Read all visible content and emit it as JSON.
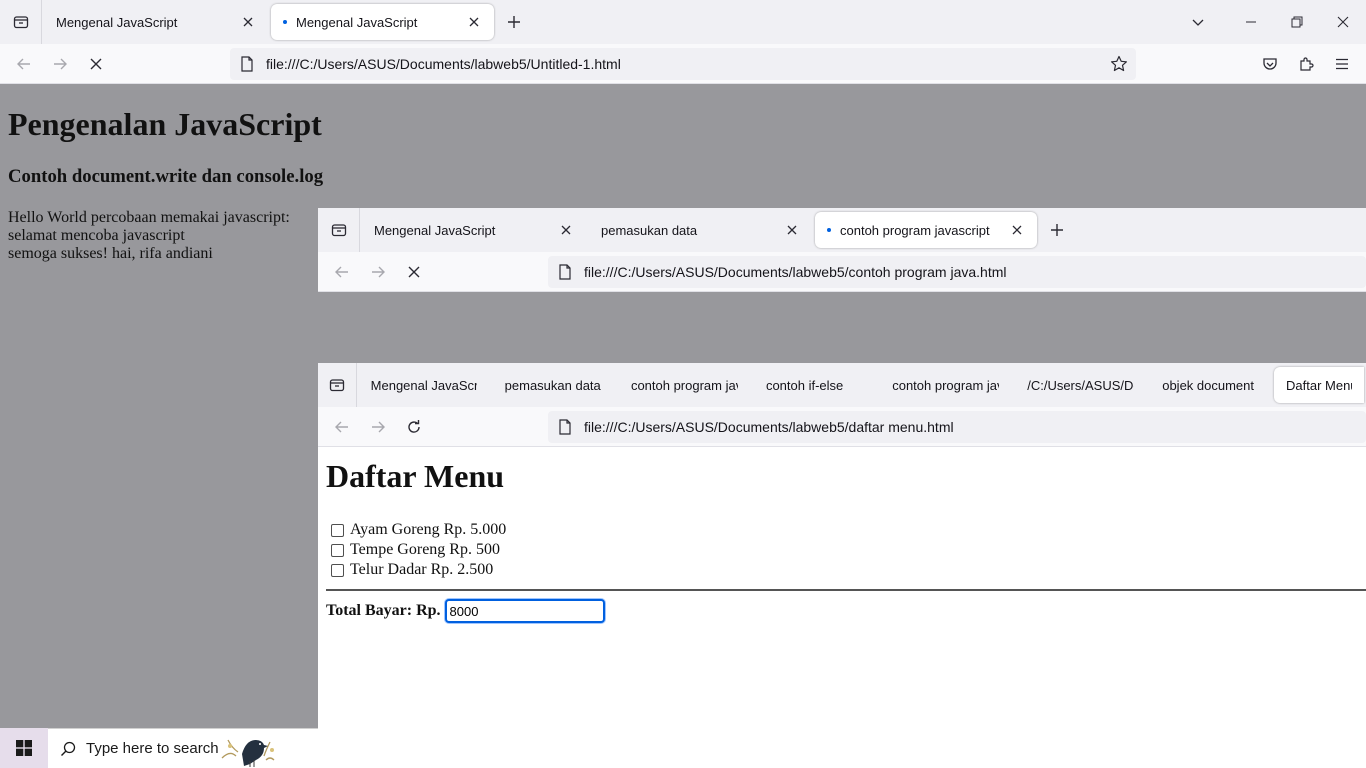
{
  "window1": {
    "tabs": [
      {
        "label": "Mengenal JavaScript",
        "active": false
      },
      {
        "label": "Mengenal JavaScript",
        "active": true,
        "loading": true
      }
    ],
    "url": "file:///C:/Users/ASUS/Documents/labweb5/Untitled-1.html",
    "content": {
      "heading": "Pengenalan JavaScript",
      "subheading": "Contoh document.write dan console.log",
      "lines": [
        "Hello World percobaan memakai javascript:",
        "selamat mencoba javascript",
        "semoga sukses! hai, rifa andiani"
      ]
    }
  },
  "window2": {
    "tabs": [
      {
        "label": "Mengenal JavaScript",
        "active": false
      },
      {
        "label": "pemasukan data",
        "active": false
      },
      {
        "label": "contoh program javascript",
        "active": true,
        "loading": true
      }
    ],
    "url": "file:///C:/Users/ASUS/Documents/labweb5/contoh program java.html"
  },
  "window3": {
    "tabs": [
      {
        "label": "Mengenal JavaScript"
      },
      {
        "label": "pemasukan data"
      },
      {
        "label": "contoh program java"
      },
      {
        "label": "contoh if-else"
      },
      {
        "label": "contoh program java"
      },
      {
        "label": "/C:/Users/ASUS/Doc"
      },
      {
        "label": "objek document"
      },
      {
        "label": "Daftar Menu",
        "active": true
      }
    ],
    "url": "file:///C:/Users/ASUS/Documents/labweb5/daftar menu.html",
    "content": {
      "heading": "Daftar Menu",
      "items": [
        {
          "label": "Ayam Goreng Rp. 5.000",
          "checked": false
        },
        {
          "label": "Tempe Goreng Rp. 500",
          "checked": false
        },
        {
          "label": "Telur Dadar Rp. 2.500",
          "checked": false
        }
      ],
      "total_label": "Total Bayar: Rp.",
      "total_value": "8000"
    }
  },
  "taskbar": {
    "search_placeholder": "Type here to search"
  },
  "colors": {
    "accent": "#0061e0",
    "page_gray": "#98989c",
    "chrome_bg": "#f0f0f4"
  }
}
